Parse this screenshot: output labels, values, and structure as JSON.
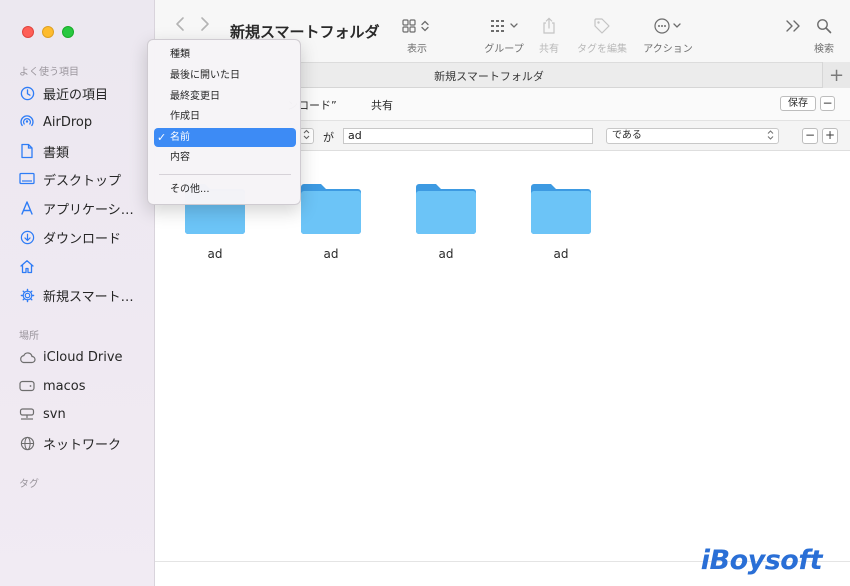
{
  "window": {
    "title": "新規スマートフォルダ"
  },
  "toolbar": {
    "view_label": "表示",
    "group_label": "グループ",
    "share_label": "共有",
    "tag_label": "タグを編集",
    "action_label": "アクション",
    "search_label": "検索"
  },
  "tab": {
    "title": "新規スマートフォルダ",
    "plus": "+"
  },
  "sidebar": {
    "favorites_heading": "よく使う項目",
    "favorites": [
      {
        "label": "最近の項目",
        "icon": "clock-icon"
      },
      {
        "label": "AirDrop",
        "icon": "airdrop-icon"
      },
      {
        "label": "書類",
        "icon": "document-icon"
      },
      {
        "label": "デスクトップ",
        "icon": "desktop-icon"
      },
      {
        "label": "アプリケーシ…",
        "icon": "applications-icon"
      },
      {
        "label": "ダウンロード",
        "icon": "download-icon"
      },
      {
        "label": "",
        "icon": "home-icon"
      },
      {
        "label": "新規スマート…",
        "icon": "gear-icon"
      }
    ],
    "locations_heading": "場所",
    "locations": [
      {
        "label": "iCloud Drive",
        "icon": "cloud-icon"
      },
      {
        "label": "macos",
        "icon": "disk-icon"
      },
      {
        "label": "svn",
        "icon": "network-drive-icon"
      },
      {
        "label": "ネットワーク",
        "icon": "globe-icon"
      }
    ],
    "tags_heading": "タグ"
  },
  "scope": {
    "partial_location": "ンロード”",
    "shared": "共有",
    "save_button": "保存",
    "remove_button": "−"
  },
  "criteria": {
    "stepper": "⌃⌄",
    "ga": "が",
    "value": "ad",
    "operator": "である",
    "remove": "−",
    "add": "+"
  },
  "files": [
    {
      "name": "ad"
    },
    {
      "name": "ad"
    },
    {
      "name": "ad"
    },
    {
      "name": "ad"
    }
  ],
  "menu": {
    "items": [
      "種類",
      "最後に開いた日",
      "最終変更日",
      "作成日",
      "名前",
      "内容"
    ],
    "selected": "名前",
    "check": "✓",
    "other": "その他..."
  },
  "watermark": "iBoysoft",
  "colors": {
    "accent": "#3d8bf5",
    "folder": "#5bb8f5",
    "sidebar_icon": "#2e7cf6"
  }
}
